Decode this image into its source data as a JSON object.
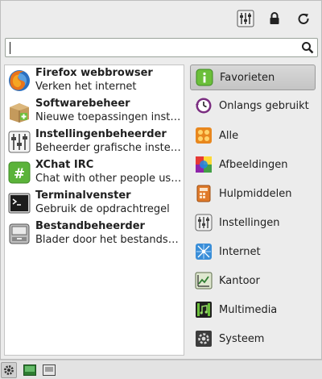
{
  "toolbar": {
    "icons": [
      "settings-panel-icon",
      "lock-icon",
      "power-icon"
    ]
  },
  "search": {
    "value": "",
    "placeholder": ""
  },
  "apps": [
    {
      "name": "Firefox webbrowser",
      "description": "Verken het internet",
      "icon": "firefox-icon"
    },
    {
      "name": "Softwarebeheer",
      "description": "Nieuwe toepassingen install...",
      "icon": "software-box-icon"
    },
    {
      "name": "Instellingenbeheerder",
      "description": "Beheerder grafische instelli...",
      "icon": "sliders-icon"
    },
    {
      "name": "XChat IRC",
      "description": "Chat with other people usin...",
      "icon": "xchat-icon"
    },
    {
      "name": "Terminalvenster",
      "description": "Gebruik de opdrachtregel",
      "icon": "terminal-icon"
    },
    {
      "name": "Bestandbeheerder",
      "description": "Blader door het bestandssy...",
      "icon": "file-manager-icon"
    }
  ],
  "categories": [
    {
      "label": "Favorieten",
      "icon": "favorites-icon",
      "active": true
    },
    {
      "label": "Onlangs gebruikt",
      "icon": "recent-icon",
      "active": false
    },
    {
      "label": "Alle",
      "icon": "all-apps-icon",
      "active": false
    },
    {
      "label": "Afbeeldingen",
      "icon": "graphics-icon",
      "active": false
    },
    {
      "label": "Hulpmiddelen",
      "icon": "accessories-icon",
      "active": false
    },
    {
      "label": "Instellingen",
      "icon": "settings-icon",
      "active": false
    },
    {
      "label": "Internet",
      "icon": "internet-icon",
      "active": false
    },
    {
      "label": "Kantoor",
      "icon": "office-icon",
      "active": false
    },
    {
      "label": "Multimedia",
      "icon": "multimedia-icon",
      "active": false
    },
    {
      "label": "Systeem",
      "icon": "system-icon",
      "active": false
    }
  ],
  "taskbar": {
    "icons": [
      "menu-gear-icon",
      "show-desktop-icon",
      "window-icon"
    ]
  },
  "colors": {
    "menu_bg": "#ececec",
    "active_category": "#c8c8c8",
    "list_bg": "#ffffff"
  }
}
